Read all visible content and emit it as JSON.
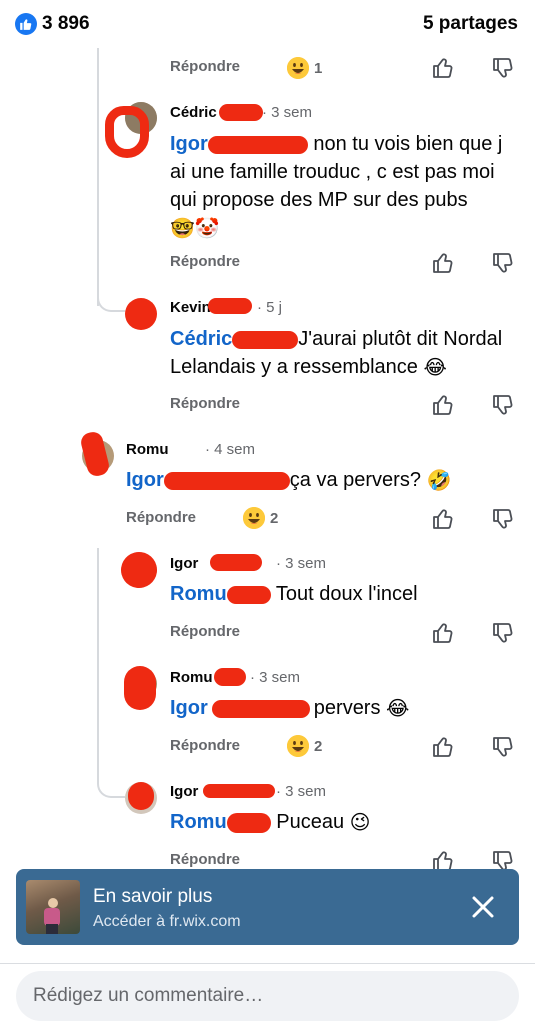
{
  "header": {
    "like_count": "3 896",
    "shares": "5 partages"
  },
  "actions": {
    "reply": "Répondre"
  },
  "comments": [
    {
      "reactions": "1"
    },
    {
      "author": "Cédric",
      "time": "· 3 sem",
      "mention": "Igor",
      "text": " non tu vois bien que j ai une famille trouduc , c est pas moi qui propose des MP sur des pubs ",
      "emojis": "🤓🤡"
    },
    {
      "author": "Kevin",
      "time": "· 5 j",
      "mention": "Cédric",
      "text": "J'aurai plutôt dit Nordal Lelandais y a ressemblance ",
      "emojis": "😂"
    },
    {
      "author": "Romu",
      "time": "· 4 sem",
      "mention": "Igor",
      "text": "ça va pervers? ",
      "emojis": "🤣",
      "reactions": "2"
    },
    {
      "author": "Igor",
      "time": "· 3 sem",
      "mention": "Romu",
      "text": " Tout doux l'incel"
    },
    {
      "author": "Romu",
      "time": "· 3 sem",
      "mention": "Igor",
      "text": "pervers ",
      "emojis": "😂",
      "reactions": "2"
    },
    {
      "author": "Igor",
      "time": "· 3 sem",
      "mention": "Romu",
      "text": " Puceau ",
      "emojis": "😉"
    }
  ],
  "ad": {
    "title": "En savoir plus",
    "subtitle": "Accéder à fr.wix.com"
  },
  "composer": {
    "placeholder": "Rédigez un commentaire…"
  },
  "icons": {
    "like": "thumbs-up-icon",
    "upvote": "upvote-icon",
    "downvote": "downvote-icon",
    "close": "close-icon",
    "laugh": "grinning-face-icon"
  },
  "colors": {
    "accent": "#1877f2",
    "mention": "#1265c9",
    "ad_background": "#3a6a93",
    "redaction": "#ee2a12"
  }
}
